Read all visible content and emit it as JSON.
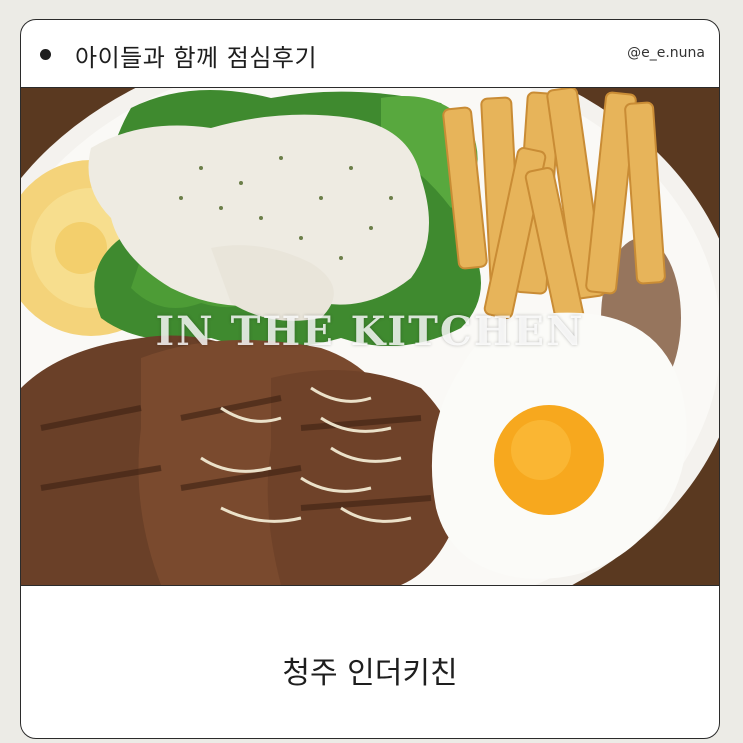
{
  "header": {
    "title": "아이들과 함께 점심후기",
    "handle": "@e_e.nuna"
  },
  "photo": {
    "overlay_text": "IN THE KITCHEN"
  },
  "footer": {
    "place": "청주 인더키친"
  },
  "colors": {
    "background": "#ecebe6",
    "card": "#ffffff",
    "border": "#2b2b2b",
    "text": "#1e1e1e"
  }
}
